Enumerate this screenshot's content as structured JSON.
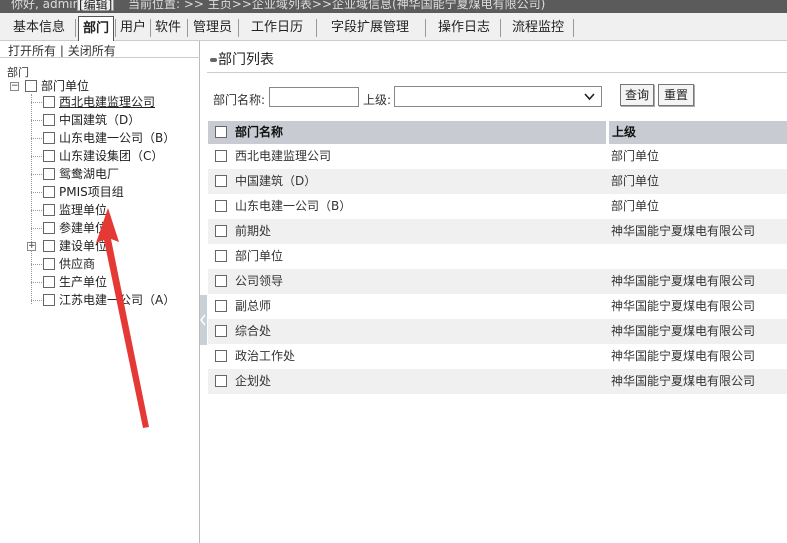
{
  "topbar": {
    "greeting": "你好, admin",
    "edit": "[编辑]",
    "location": "当前位置: >> 主页>>企业域列表>>企业域信息(神华国能宁夏煤电有限公司)"
  },
  "nav": {
    "tabs": [
      "基本信息",
      "部门",
      "用户",
      "软件",
      "管理员",
      "工作日历",
      "字段扩展管理",
      "操作日志",
      "流程监控"
    ],
    "active": "部门"
  },
  "tree": {
    "open_all": "打开所有",
    "divider": "|",
    "close_all": "关闭所有",
    "root_label": "部门",
    "root_node": "部门单位",
    "children": [
      "西北电建监理公司",
      "中国建筑（D）",
      "山东电建一公司（B）",
      "山东建设集团（C）",
      "鸳鸯湖电厂",
      "PMIS项目组",
      "监理单位",
      "参建单位",
      "建设单位",
      "供应商",
      "生产单位",
      "江苏电建一公司（A）"
    ]
  },
  "panel": {
    "title": "部门列表",
    "filter_name_label": "部门名称:",
    "filter_name_value": "",
    "filter_parent_label": "上级:",
    "filter_parent_value": "",
    "query_button": "查询",
    "reset_button": "重置"
  },
  "table": {
    "headers": [
      "部门名称",
      "上级"
    ],
    "rows": [
      [
        "西北电建监理公司",
        "部门单位"
      ],
      [
        "中国建筑（D）",
        "部门单位"
      ],
      [
        "山东电建一公司（B）",
        "部门单位"
      ],
      [
        "前期处",
        "神华国能宁夏煤电有限公司"
      ],
      [
        "部门单位",
        ""
      ],
      [
        "公司领导",
        "神华国能宁夏煤电有限公司"
      ],
      [
        "副总师",
        "神华国能宁夏煤电有限公司"
      ],
      [
        "综合处",
        "神华国能宁夏煤电有限公司"
      ],
      [
        "政治工作处",
        "神华国能宁夏煤电有限公司"
      ],
      [
        "企划处",
        "神华国能宁夏煤电有限公司"
      ]
    ]
  },
  "colors": {
    "annotation_arrow": "#e53935",
    "header_bg": "#c8ccd2",
    "alt_row": "#f0f0f0"
  }
}
